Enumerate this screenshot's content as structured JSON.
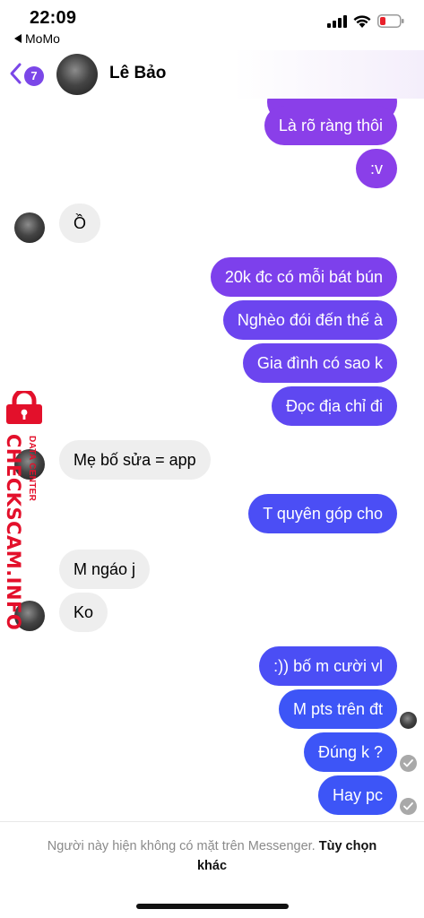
{
  "status_bar": {
    "time": "22:09",
    "back_app": "MoMo",
    "icons": [
      "signal-icon",
      "wifi-icon",
      "battery-icon"
    ]
  },
  "header": {
    "unread_count": "7",
    "contact_name": "Lê Bảo"
  },
  "messages": [
    {
      "from": "me",
      "text": "Là rõ ràng thôi"
    },
    {
      "from": "me",
      "text": ":v"
    },
    {
      "from": "them",
      "text": "Ồ"
    },
    {
      "from": "me",
      "text": "20k đc có mỗi bát bún"
    },
    {
      "from": "me",
      "text": "Nghèo đói đến thế à"
    },
    {
      "from": "me",
      "text": "Gia đình có sao k"
    },
    {
      "from": "me",
      "text": "Đọc địa chỉ đi"
    },
    {
      "from": "them",
      "text": "Mẹ bố sửa = app"
    },
    {
      "from": "me",
      "text": "T quyên góp cho"
    },
    {
      "from": "them",
      "text": "M ngáo j"
    },
    {
      "from": "them",
      "text": "Ko"
    },
    {
      "from": "me",
      "text": ":)) bố m cười vl"
    },
    {
      "from": "me",
      "text": "M pts trên đt"
    },
    {
      "from": "me",
      "text": "Đúng k ?"
    },
    {
      "from": "me",
      "text": "Hay pc"
    }
  ],
  "watermark": {
    "site": "CHECKSCAM.INFO",
    "subtitle": "DATA CENTER"
  },
  "footer": {
    "notice": "Người này hiện không có mặt trên Messenger.",
    "option": "Tùy chọn khác"
  },
  "colors": {
    "accent": "#7b47e8",
    "bubble_top": "#8a3fe9",
    "bubble_bottom": "#3d55f7",
    "incoming_bubble": "#eeeeee",
    "watermark": "#e3102b"
  }
}
